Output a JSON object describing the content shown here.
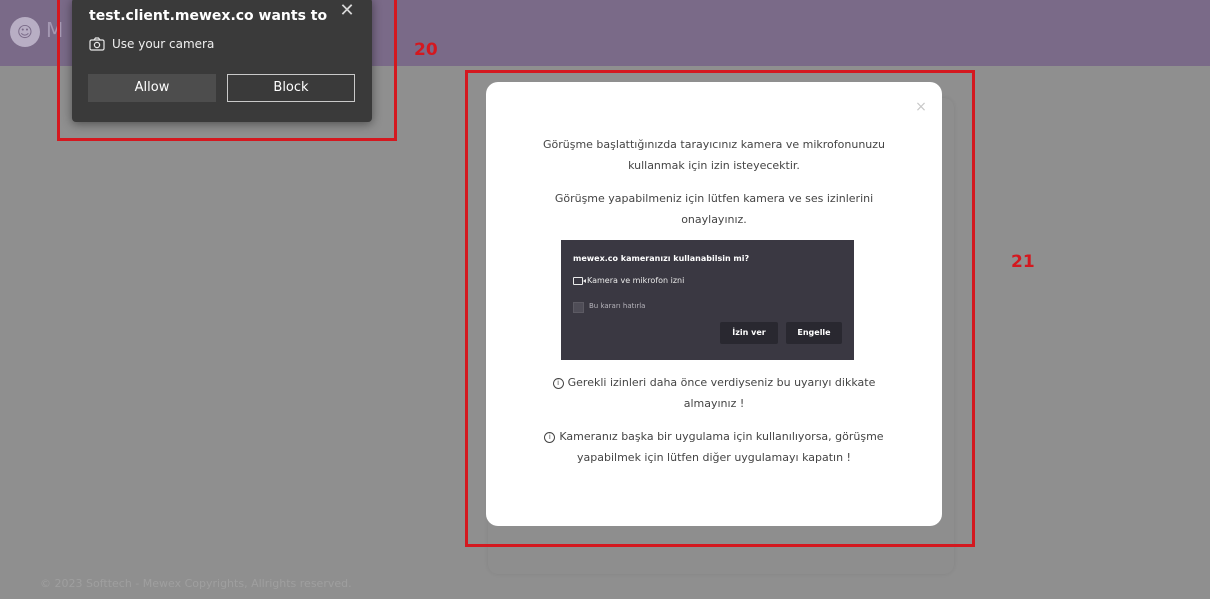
{
  "app": {
    "logo_icon": "people-icon",
    "name_partial": "M"
  },
  "footer": {
    "text": "© 2023 Softtech - Mewex Copyrights, Allrights reserved."
  },
  "permission_popup": {
    "title": "test.client.mewex.co wants to",
    "permission_label": "Use your camera",
    "permission_icon": "camera-icon",
    "allow_label": "Allow",
    "block_label": "Block",
    "close_glyph": "✕"
  },
  "modal": {
    "close_glyph": "×",
    "paragraph_1": "Görüşme başlattığınızda tarayıcınız kamera ve mikrofonunuzu kullanmak için izin isteyecektir.",
    "paragraph_2": "Görüşme yapabilmeniz için lütfen kamera ve ses izinlerini onaylayınız.",
    "preview": {
      "title": "mewex.co kameranızı kullanabilsin mi?",
      "permission_label": "Kamera ve mikrofon izni",
      "remember_label": "Bu kararı hatırla",
      "allow_label": "İzin ver",
      "block_label": "Engelle"
    },
    "info_1": "Gerekli izinleri daha önce verdiyseniz bu uyarıyı dikkate almayınız !",
    "info_2": "Kameranız başka bir uygulama için kullanılıyorsa, görüşme yapabilmek için lütfen diğer uygulamayı kapatın !"
  },
  "annotations": {
    "label_20": "20",
    "label_21": "21",
    "color": "#d4181f"
  },
  "colors": {
    "header": "#7a6a88",
    "overlay": "#8f8f8f",
    "popup": "#3a3a3a"
  }
}
